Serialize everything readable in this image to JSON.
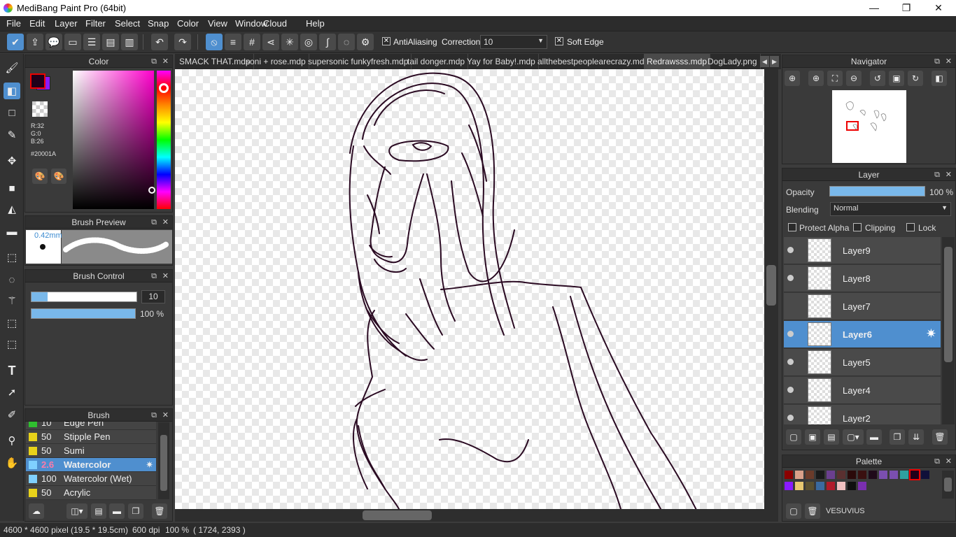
{
  "window": {
    "title": "MediBang Paint Pro (64bit)",
    "minimize": "—",
    "maximize": "❐",
    "close": "✕"
  },
  "menu": [
    "File",
    "Edit",
    "Layer",
    "Filter",
    "Select",
    "Snap",
    "Color",
    "View",
    "Window",
    "Cloud",
    "Help"
  ],
  "toolbar": {
    "antialiasing_label": "AntiAliasing",
    "correction_label": "Correction",
    "correction_value": "10",
    "soft_edge_label": "Soft Edge",
    "check": "✕"
  },
  "color_panel": {
    "title": "Color",
    "r": "R:32",
    "g": "G:0",
    "b": "B:26",
    "hex": "#20001A",
    "main_color": "#20001A",
    "sub_color": "#8a1aff"
  },
  "brush_preview": {
    "title": "Brush Preview",
    "size": "0.42mm"
  },
  "brush_control": {
    "title": "Brush Control",
    "size_value": "10",
    "size_fraction": 0.15,
    "opacity_label": "100 %",
    "opacity_fraction": 1.0
  },
  "brush_panel": {
    "title": "Brush",
    "items": [
      {
        "size": "10",
        "name": "Edge Pen",
        "color": "#2fbf2f"
      },
      {
        "size": "50",
        "name": "Stipple Pen",
        "color": "#e8d21a"
      },
      {
        "size": "50",
        "name": "Sumi",
        "color": "#e8d21a"
      },
      {
        "size": "2.6",
        "name": "Watercolor",
        "color": "#7fd0ff",
        "selected": true
      },
      {
        "size": "100",
        "name": "Watercolor (Wet)",
        "color": "#7fd0ff"
      },
      {
        "size": "50",
        "name": "Acrylic",
        "color": "#e8d21a"
      }
    ]
  },
  "tabs": [
    {
      "label": "SMACK THAT.mdp"
    },
    {
      "label": "soni + rose.mdp"
    },
    {
      "label": "supersonic funkyfresh.mdp"
    },
    {
      "label": "tail donger.mdp"
    },
    {
      "label": "Yay for Baby!.mdp"
    },
    {
      "label": "allthebestpeoplearecrazy.mdp"
    },
    {
      "label": "Redrawsss.mdp",
      "selected": true
    },
    {
      "label": "DogLady.png"
    }
  ],
  "navigator": {
    "title": "Navigator"
  },
  "layer_panel": {
    "title": "Layer",
    "opacity_label": "Opacity",
    "opacity_value": "100 %",
    "opacity_fraction": 1.0,
    "blending_label": "Blending",
    "blending_value": "Normal",
    "protect_alpha": "Protect Alpha",
    "clipping": "Clipping",
    "lock": "Lock",
    "layers": [
      {
        "name": "Layer9",
        "visible": true
      },
      {
        "name": "Layer8",
        "visible": true
      },
      {
        "name": "Layer7",
        "visible": false
      },
      {
        "name": "Layer6",
        "visible": true,
        "selected": true
      },
      {
        "name": "Layer5",
        "visible": true
      },
      {
        "name": "Layer4",
        "visible": true
      },
      {
        "name": "Layer2",
        "visible": true
      }
    ]
  },
  "palette": {
    "title": "Palette",
    "name": "VESUVIUS",
    "colors": [
      "#8b0000",
      "#d9a08a",
      "#6b3b2a",
      "#1a1a1a",
      "#6b3f8f",
      "#5a3030",
      "#2b0a0a",
      "#3a1010",
      "#1f0a1a",
      "#7b4fb0",
      "#7b4fb0",
      "#2fa0a0",
      "#20001A",
      "#10103a",
      "#8a1aff",
      "#e8c870",
      "#5a5030",
      "#3a6aa0",
      "#b01a2a",
      "#f0c0c0",
      "#101010",
      "#7a2fb0"
    ]
  },
  "status": {
    "dimensions": "4600 * 4600 pixel",
    "physical": "(19.5 * 19.5cm)",
    "dpi": "600 dpi",
    "zoom": "100 %",
    "coords": "( 1724, 2393 )"
  }
}
